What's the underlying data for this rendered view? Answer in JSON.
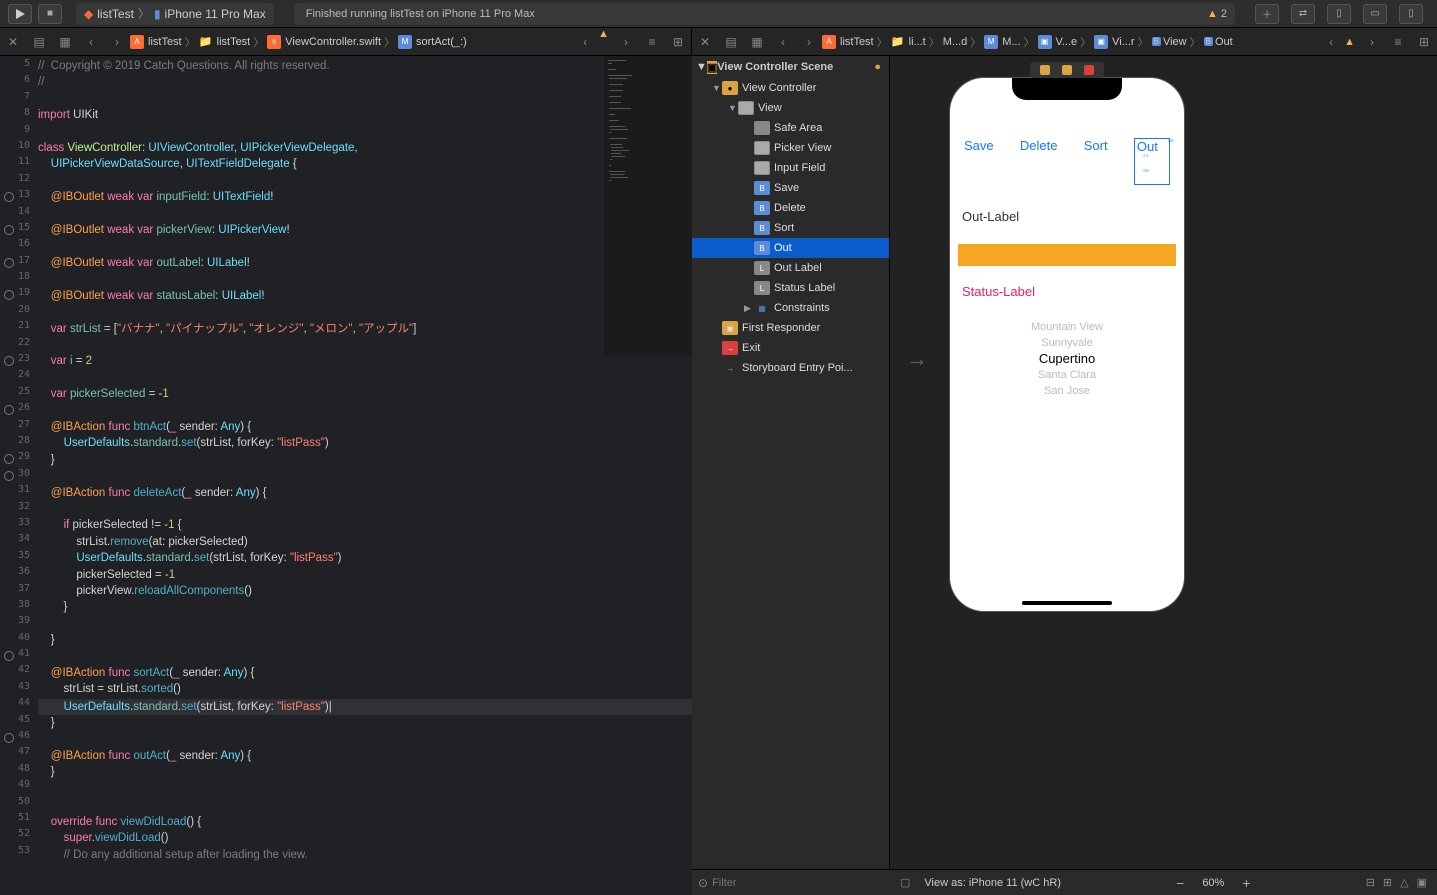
{
  "toolbar": {
    "scheme_target": "listTest",
    "scheme_device": "iPhone 11 Pro Max",
    "status_text": "Finished running listTest on iPhone 11 Pro Max",
    "warning_count": "2"
  },
  "left_crumb": {
    "items": [
      "listTest",
      "listTest",
      "ViewController.swift",
      "sortAct(_:)"
    ]
  },
  "right_crumb": {
    "items": [
      "listTest",
      "li...t",
      "M...d",
      "M...",
      "V...e",
      "Vi...r",
      "View",
      "Out"
    ]
  },
  "gutter_start": 5,
  "gutter_end": 53,
  "bp_lines": [
    13,
    15,
    17,
    19,
    23,
    26,
    29,
    30,
    41,
    46
  ],
  "code_lines": [
    {
      "t": "//  Copyright © 2019 Catch Questions. All rights reserved.",
      "cls": "k-comment"
    },
    {
      "t": "//",
      "cls": "k-comment"
    },
    {
      "t": ""
    },
    {
      "t": "import UIKit",
      "seg": [
        [
          "import ",
          "k-keyword"
        ],
        [
          "UIKit",
          ""
        ]
      ]
    },
    {
      "t": ""
    },
    {
      "seg": [
        [
          "class ",
          "k-keyword"
        ],
        [
          "ViewController",
          "k-class"
        ],
        [
          ": ",
          ""
        ],
        [
          "UIViewController",
          "k-type"
        ],
        [
          ", ",
          ""
        ],
        [
          "UIPickerViewDelegate",
          "k-type"
        ],
        [
          ",",
          ""
        ]
      ]
    },
    {
      "seg": [
        [
          "    UIPickerViewDataSource",
          ""
        ],
        [
          ", ",
          ""
        ],
        [
          "UITextFieldDelegate",
          "k-type"
        ],
        [
          " {",
          ""
        ]
      ],
      "pre": "    ",
      "raw": "    UIPickerViewDataSource, UITextFieldDelegate {",
      "custom": true,
      "html": "    <span class='k-type'>UIPickerViewDataSource</span>, <span class='k-type'>UITextFieldDelegate</span> {"
    },
    {
      "t": ""
    },
    {
      "html": "    <span class='k-attr'>@IBOutlet</span> <span class='k-keyword'>weak</span> <span class='k-keyword'>var</span> <span class='k-prop'>inputField</span>: <span class='k-type'>UITextField</span>!"
    },
    {
      "t": ""
    },
    {
      "html": "    <span class='k-attr'>@IBOutlet</span> <span class='k-keyword'>weak</span> <span class='k-keyword'>var</span> <span class='k-prop'>pickerView</span>: <span class='k-type'>UIPickerView</span>!"
    },
    {
      "t": ""
    },
    {
      "html": "    <span class='k-attr'>@IBOutlet</span> <span class='k-keyword'>weak</span> <span class='k-keyword'>var</span> <span class='k-prop'>outLabel</span>: <span class='k-type'>UILabel</span>!"
    },
    {
      "t": ""
    },
    {
      "html": "    <span class='k-attr'>@IBOutlet</span> <span class='k-keyword'>weak</span> <span class='k-keyword'>var</span> <span class='k-prop'>statusLabel</span>: <span class='k-type'>UILabel</span>!"
    },
    {
      "t": ""
    },
    {
      "html": "    <span class='k-keyword'>var</span> <span class='k-prop'>strList</span> = [<span class='k-string'>\"バナナ\"</span>, <span class='k-string'>\"パイナップル\"</span>, <span class='k-string'>\"オレンジ\"</span>, <span class='k-string'>\"メロン\"</span>, <span class='k-string'>\"アップル\"</span>]"
    },
    {
      "t": ""
    },
    {
      "html": "    <span class='k-keyword'>var</span> <span class='k-prop'>i</span> = <span class='k-num'>2</span>"
    },
    {
      "t": ""
    },
    {
      "html": "    <span class='k-keyword'>var</span> <span class='k-prop'>pickerSelected</span> = -<span class='k-num'>1</span>"
    },
    {
      "t": ""
    },
    {
      "html": "    <span class='k-attr'>@IBAction</span> <span class='k-keyword'>func</span> <span class='k-func'>btnAct</span>(<span class='k-keyword'>_</span> sender: <span class='k-type'>Any</span>) {"
    },
    {
      "html": "        <span class='k-type'>UserDefaults</span>.<span class='k-prop'>standard</span>.<span class='k-func'>set</span>(strList, forKey: <span class='k-string'>\"listPass\"</span>)"
    },
    {
      "t": "    }"
    },
    {
      "t": ""
    },
    {
      "html": "    <span class='k-attr'>@IBAction</span> <span class='k-keyword'>func</span> <span class='k-func'>deleteAct</span>(<span class='k-keyword'>_</span> sender: <span class='k-type'>Any</span>) {"
    },
    {
      "t": ""
    },
    {
      "html": "        <span class='k-keyword'>if</span> pickerSelected != -<span class='k-num'>1</span> {"
    },
    {
      "html": "            strList.<span class='k-func'>remove</span>(at: pickerSelected)"
    },
    {
      "html": "            <span class='k-type'>UserDefaults</span>.<span class='k-prop'>standard</span>.<span class='k-func'>set</span>(strList, forKey: <span class='k-string'>\"listPass\"</span>)"
    },
    {
      "html": "            pickerSelected = -<span class='k-num'>1</span>"
    },
    {
      "html": "            pickerView.<span class='k-func'>reloadAllComponents</span>()"
    },
    {
      "t": "        }"
    },
    {
      "t": ""
    },
    {
      "t": "    }"
    },
    {
      "t": ""
    },
    {
      "html": "    <span class='k-attr'>@IBAction</span> <span class='k-keyword'>func</span> <span class='k-func'>sortAct</span>(<span class='k-keyword'>_</span> sender: <span class='k-type'>Any</span>) {"
    },
    {
      "html": "        strList = strList.<span class='k-func'>sorted</span>()"
    },
    {
      "html": "        <span class='k-type'>UserDefaults</span>.<span class='k-prop'>standard</span>.<span class='k-func'>set</span>(strList, forKey: <span class='k-string'>\"listPass\"</span>)|",
      "hl": true
    },
    {
      "t": "    }"
    },
    {
      "t": ""
    },
    {
      "html": "    <span class='k-attr'>@IBAction</span> <span class='k-keyword'>func</span> <span class='k-func'>outAct</span>(<span class='k-keyword'>_</span> sender: <span class='k-type'>Any</span>) {"
    },
    {
      "t": "    }"
    },
    {
      "t": ""
    },
    {
      "t": ""
    },
    {
      "html": "    <span class='k-override'>override</span> <span class='k-keyword'>func</span> <span class='k-func'>viewDidLoad</span>() {"
    },
    {
      "html": "        <span class='k-keyword'>super</span>.<span class='k-func'>viewDidLoad</span>()"
    },
    {
      "html": "        <span class='k-comment'>// Do any additional setup after loading the view.</span>"
    }
  ],
  "outline": {
    "header": "View Controller Scene",
    "rows": [
      {
        "indent": 1,
        "icon": "vc",
        "label": "View Controller",
        "disc": "▼"
      },
      {
        "indent": 2,
        "icon": "view",
        "label": "View",
        "disc": "▼"
      },
      {
        "indent": 3,
        "icon": "safe",
        "label": "Safe Area"
      },
      {
        "indent": 3,
        "icon": "view",
        "label": "Picker View"
      },
      {
        "indent": 3,
        "icon": "view",
        "label": "Input Field"
      },
      {
        "indent": 3,
        "icon": "b",
        "label": "Save"
      },
      {
        "indent": 3,
        "icon": "b",
        "label": "Delete"
      },
      {
        "indent": 3,
        "icon": "b",
        "label": "Sort"
      },
      {
        "indent": 3,
        "icon": "b",
        "label": "Out",
        "sel": true
      },
      {
        "indent": 3,
        "icon": "l",
        "label": "Out Label"
      },
      {
        "indent": 3,
        "icon": "l",
        "label": "Status Label"
      },
      {
        "indent": 3,
        "icon": "con",
        "label": "Constraints",
        "disc": "▶"
      },
      {
        "indent": 1,
        "icon": "fr",
        "label": "First Responder"
      },
      {
        "indent": 1,
        "icon": "exit",
        "label": "Exit"
      },
      {
        "indent": 1,
        "icon": "arrow",
        "label": "Storyboard Entry Poi..."
      }
    ]
  },
  "device": {
    "buttons": [
      "Save",
      "Delete",
      "Sort",
      "Out"
    ],
    "out_label": "Out-Label",
    "status_label": "Status-Label",
    "picker": [
      "Mountain View",
      "Sunnyvale",
      "Cupertino",
      "Santa Clara",
      "San Jose"
    ],
    "picker_selected_index": 2
  },
  "filter_placeholder": "Filter",
  "canvas_footer": {
    "view_as": "View as: iPhone 11 (wC hR)",
    "zoom": "60%"
  }
}
